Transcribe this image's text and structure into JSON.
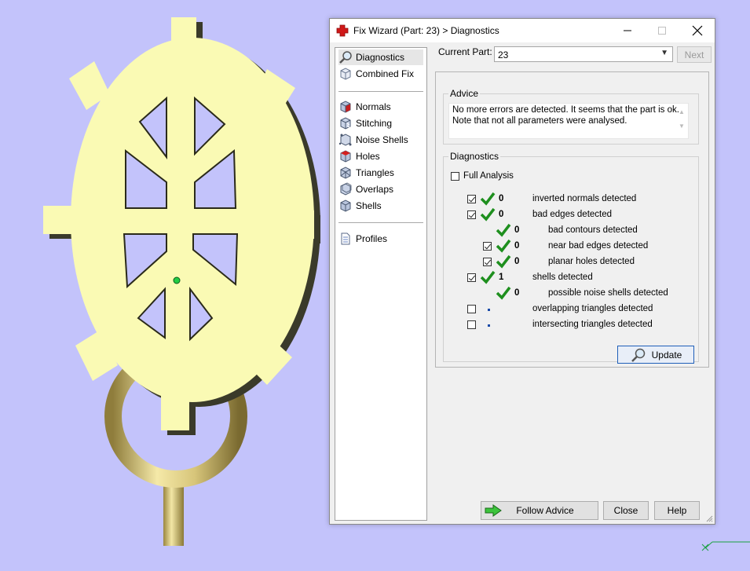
{
  "window": {
    "title": "Fix Wizard (Part: 23) > Diagnostics",
    "minimize_label": "—",
    "maximize_label": "☐",
    "close_label": "✕"
  },
  "sidebar": {
    "items": [
      {
        "label": "Diagnostics",
        "icon": "magnifier-icon"
      },
      {
        "label": "Combined Fix",
        "icon": "cube-icon"
      },
      {
        "label": "Normals",
        "icon": "normals-cube-icon"
      },
      {
        "label": "Stitching",
        "icon": "stitching-cube-icon"
      },
      {
        "label": "Noise Shells",
        "icon": "noise-shells-icon"
      },
      {
        "label": "Holes",
        "icon": "holes-cube-icon"
      },
      {
        "label": "Triangles",
        "icon": "triangles-cube-icon"
      },
      {
        "label": "Overlaps",
        "icon": "overlaps-cube-icon"
      },
      {
        "label": "Shells",
        "icon": "shells-cube-icon"
      },
      {
        "label": "Profiles",
        "icon": "document-icon"
      }
    ]
  },
  "current_part": {
    "label": "Current Part:",
    "value": "23",
    "next_label": "Next"
  },
  "advice": {
    "title": "Advice",
    "text": "No more errors are detected. It seems that the part is ok.\nNote that not all parameters were analysed."
  },
  "diagnostics": {
    "title": "Diagnostics",
    "full_analysis_label": "Full Analysis",
    "rows": [
      {
        "count": "0",
        "label": "inverted normals detected"
      },
      {
        "count": "0",
        "label": "bad edges detected"
      },
      {
        "count": "0",
        "label": "bad contours detected"
      },
      {
        "count": "0",
        "label": "near bad edges detected"
      },
      {
        "count": "0",
        "label": "planar holes detected"
      },
      {
        "count": "1",
        "label": "shells detected"
      },
      {
        "count": "0",
        "label": "possible noise shells detected"
      },
      {
        "count": "",
        "label": "overlapping triangles detected"
      },
      {
        "count": "",
        "label": "intersecting triangles detected"
      }
    ],
    "update_label": "Update"
  },
  "footer": {
    "follow_advice_label": "Follow Advice",
    "close_label": "Close",
    "help_label": "Help"
  },
  "colors": {
    "viewport_bg": "#c3c3fb",
    "model_face": "#fafab4",
    "model_ring": "#c9b76a",
    "ok_green": "#1e8f1e",
    "accent_blue": "#1f5fb8"
  }
}
